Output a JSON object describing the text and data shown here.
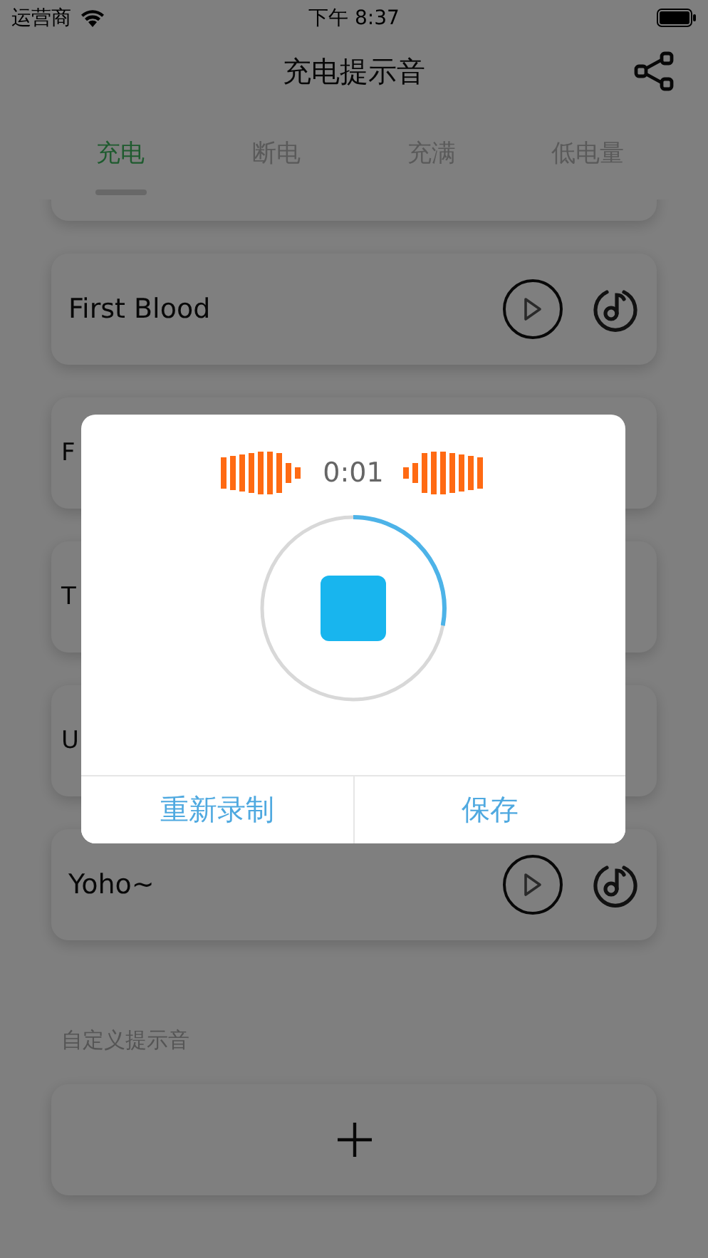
{
  "status_bar": {
    "carrier": "运营商",
    "time": "下午 8:37"
  },
  "title": "充电提示音",
  "tabs": [
    {
      "label": "充电",
      "selected": true
    },
    {
      "label": "断电",
      "selected": false
    },
    {
      "label": "充满",
      "selected": false
    },
    {
      "label": "低电量",
      "selected": false
    }
  ],
  "sounds": [
    {
      "kind": "clipped"
    },
    {
      "kind": "sound",
      "name": "First Blood"
    },
    {
      "kind": "covered",
      "name": "F"
    },
    {
      "kind": "covered",
      "name": "T"
    },
    {
      "kind": "covered",
      "name": "U"
    },
    {
      "kind": "sound",
      "name": "Yoho~"
    }
  ],
  "section_label": "自定义提示音",
  "dialog": {
    "time": "0:01",
    "level": 0.28,
    "buttons": [
      "重新录制",
      "保存"
    ]
  }
}
